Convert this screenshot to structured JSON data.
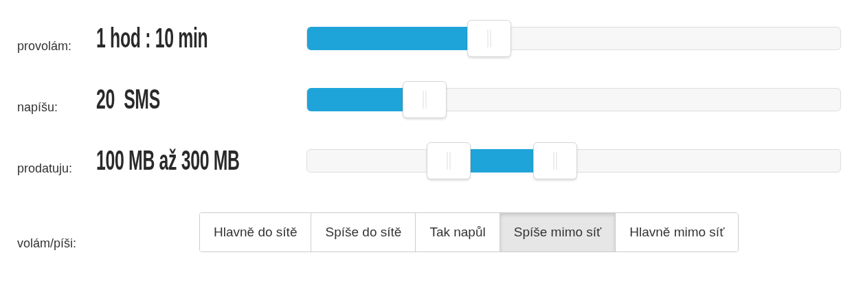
{
  "sliders": [
    {
      "label": "provolám:",
      "value": "1 hod : 10 min",
      "kind": "single",
      "handles": [
        {
          "level": 0.342
        }
      ]
    },
    {
      "label": "napíšu:",
      "value": "20  SMS",
      "kind": "single",
      "handles": [
        {
          "level": 0.221
        }
      ]
    },
    {
      "label": "prodatuju:",
      "value": "100 MB až 300 MB",
      "kind": "range",
      "handles": [
        {
          "level": 0.266
        },
        {
          "level": 0.465
        }
      ]
    }
  ],
  "choice": {
    "label": "volám/píši:",
    "options": [
      {
        "label": "Hlavně do sítě",
        "selected": false
      },
      {
        "label": "Spíše do sítě",
        "selected": false
      },
      {
        "label": "Tak napůl",
        "selected": false
      },
      {
        "label": "Spíše mimo síť",
        "selected": true
      },
      {
        "label": "Hlavně mimo síť",
        "selected": false
      }
    ]
  }
}
